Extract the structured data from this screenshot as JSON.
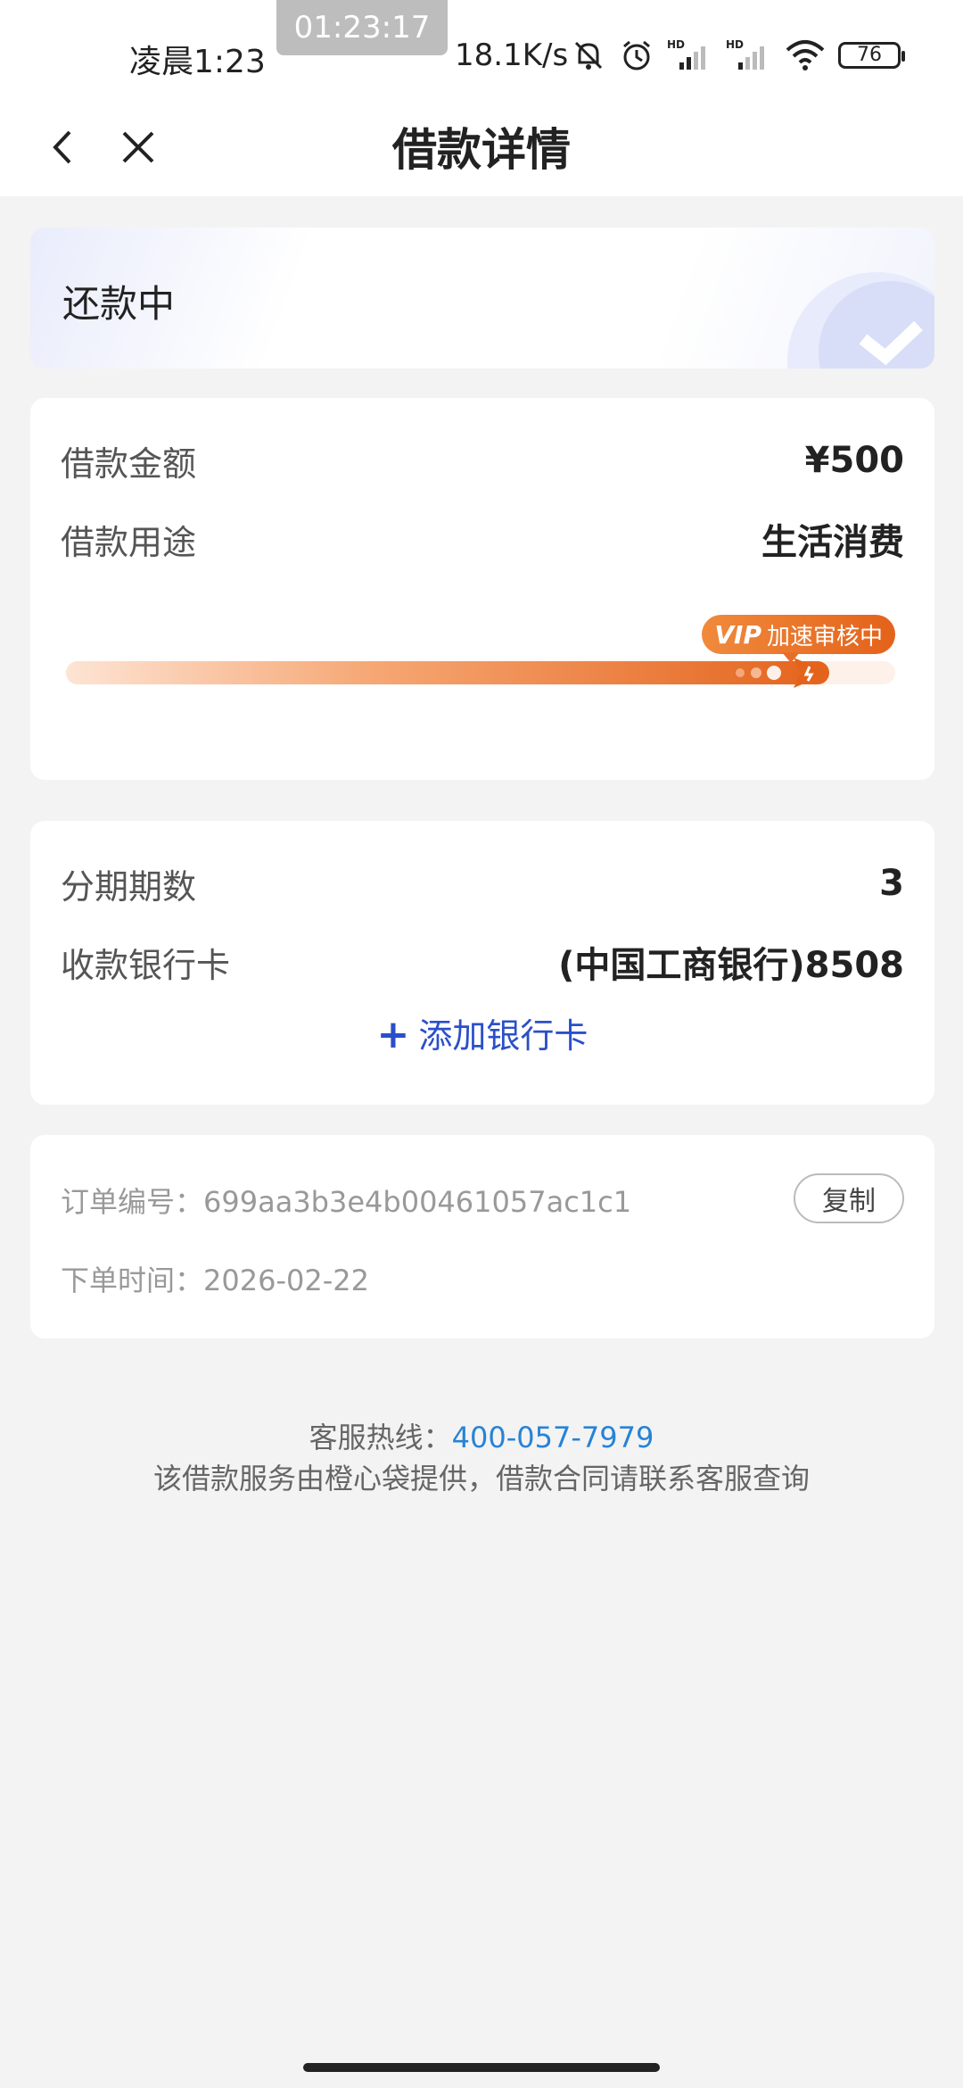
{
  "status_bar": {
    "time": "凌晨1:23",
    "recording_time": "01:23:17",
    "net_speed": "18.1K/s",
    "battery": "76",
    "icons": [
      "mute-bell-icon",
      "alarm-icon",
      "hd-signal-icon",
      "hd-signal-icon",
      "wifi-icon",
      "battery-icon"
    ]
  },
  "nav": {
    "title": "借款详情",
    "back_icon": "chevron-left-icon",
    "close_icon": "close-icon"
  },
  "status_card": {
    "label": "还款中"
  },
  "loan": {
    "amount_label": "借款金额",
    "amount_value": "¥500",
    "purpose_label": "借款用途",
    "purpose_value": "生活消费",
    "progress_tag_vip": "VIP",
    "progress_tag_text": "加速审核中",
    "progress": 0.92,
    "accent": "#e4631c"
  },
  "installment": {
    "periods_label": "分期期数",
    "periods_value": "3",
    "bank_label": "收款银行卡",
    "bank_value": "(中国工商银行)8508",
    "add_card_plus": "+",
    "add_card_label": "添加银行卡"
  },
  "order": {
    "order_no_label": "订单编号：",
    "order_no": "699aa3b3e4b00461057ac1c1",
    "copy_label": "复制",
    "time_label": "下单时间：",
    "time_value": "2026-02-22"
  },
  "footer": {
    "hotline_label": "客服热线：",
    "hotline": "400-057-7979",
    "note": "该借款服务由橙心袋提供，借款合同请联系客服查询"
  }
}
